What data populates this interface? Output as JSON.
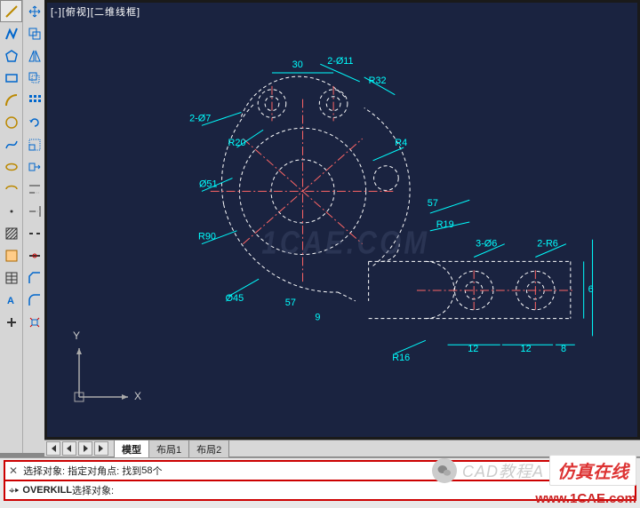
{
  "viewport": {
    "label": "[-][俯视][二维线框]"
  },
  "ucs": {
    "x": "X",
    "y": "Y"
  },
  "tabs": {
    "model": "模型",
    "layout1": "布局1",
    "layout2": "布局2"
  },
  "command": {
    "line1_prefix": "选择对象: 指定对角点: 找到 ",
    "line1_count": "58",
    "line1_suffix": " 个",
    "line2_cmd": "OVERKILL",
    "line2_suffix": " 选择对象:"
  },
  "dimensions": {
    "d30": "30",
    "d2phi11": "2-Ø11",
    "r32": "R32",
    "d2phi7": "2-Ø7",
    "r20": "R20",
    "r4": "R4",
    "phi51": "Ø51",
    "r90": "R90",
    "d57": "57",
    "r19": "R19",
    "phi45": "Ø45",
    "d3phi6": "3-Ø6",
    "d2r6": "2-R6",
    "d6": "6",
    "d57b": "57",
    "d9": "9",
    "r16": "R16",
    "d12a": "12",
    "d12b": "12",
    "d8": "8"
  },
  "watermarks": {
    "center": "1CAE.COM",
    "cad": "CAD教程A",
    "fzzx": "仿真在线",
    "url": "www.1CAE.com"
  },
  "tools_col1": [
    "line-icon",
    "polyline-icon",
    "polygon-icon",
    "rectangle-icon",
    "arc-icon",
    "circle-icon",
    "spline-icon",
    "ellipse-icon",
    "ellipse-arc-icon",
    "point-icon",
    "hatch-icon",
    "region-icon",
    "table-icon",
    "mtext-icon",
    "add-icon"
  ],
  "tools_col2": [
    "move-icon",
    "copy-icon",
    "mirror-icon",
    "offset-icon",
    "array-icon",
    "rotate-icon",
    "scale-icon",
    "stretch-icon",
    "trim-icon",
    "extend-icon",
    "break-icon",
    "join-icon",
    "chamfer-icon",
    "fillet-icon",
    "explode-icon"
  ],
  "colors": {
    "entity": "#00ffff",
    "selected_dash": "#ffffff",
    "centerline": "#ff6666",
    "accent": "#00ff66"
  }
}
